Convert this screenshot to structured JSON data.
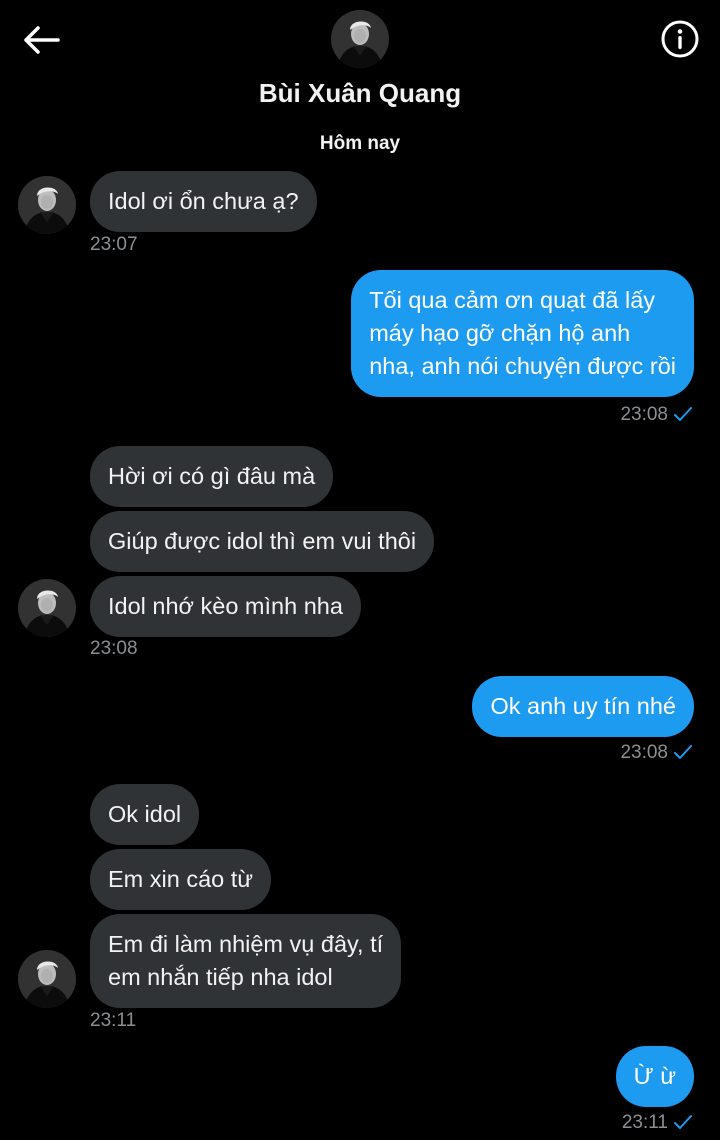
{
  "header": {
    "contact_name": "Bùi Xuân Quang",
    "back_icon": "arrow-left-icon",
    "info_icon": "info-circle-icon"
  },
  "day_separator": "Hôm nay",
  "colors": {
    "background": "#000000",
    "incoming_bubble": "#2f3336",
    "outgoing_bubble": "#1d9bf0",
    "timestamp": "#8b8f93",
    "read_tick": "#1d9bf0"
  },
  "messages": [
    {
      "side": "in",
      "text": "Idol ơi ổn chưa ạ?"
    },
    {
      "side": "in",
      "time": "23:07"
    },
    {
      "side": "out",
      "text": "Tối qua cảm ơn quạt đã lấy\nmáy hạo gỡ chặn hộ anh\nnha, anh nói chuyện được rồi"
    },
    {
      "side": "out",
      "time": "23:08"
    },
    {
      "side": "in",
      "text": "Hời ơi có gì đâu mà"
    },
    {
      "side": "in",
      "text": "Giúp được idol thì em vui thôi"
    },
    {
      "side": "in",
      "text": "Idol nhớ kèo mình nha"
    },
    {
      "side": "in",
      "time": "23:08"
    },
    {
      "side": "out",
      "text": "Ok anh uy tín nhé"
    },
    {
      "side": "out",
      "time": "23:08"
    },
    {
      "side": "in",
      "text": "Ok idol"
    },
    {
      "side": "in",
      "text": "Em xin cáo từ"
    },
    {
      "side": "in",
      "text": "Em đi làm nhiệm vụ đây, tí\nem nhắn tiếp nha idol"
    },
    {
      "side": "in",
      "time": "23:11"
    },
    {
      "side": "out",
      "text": "Ừ ừ"
    },
    {
      "side": "out",
      "time": "23:11"
    }
  ]
}
